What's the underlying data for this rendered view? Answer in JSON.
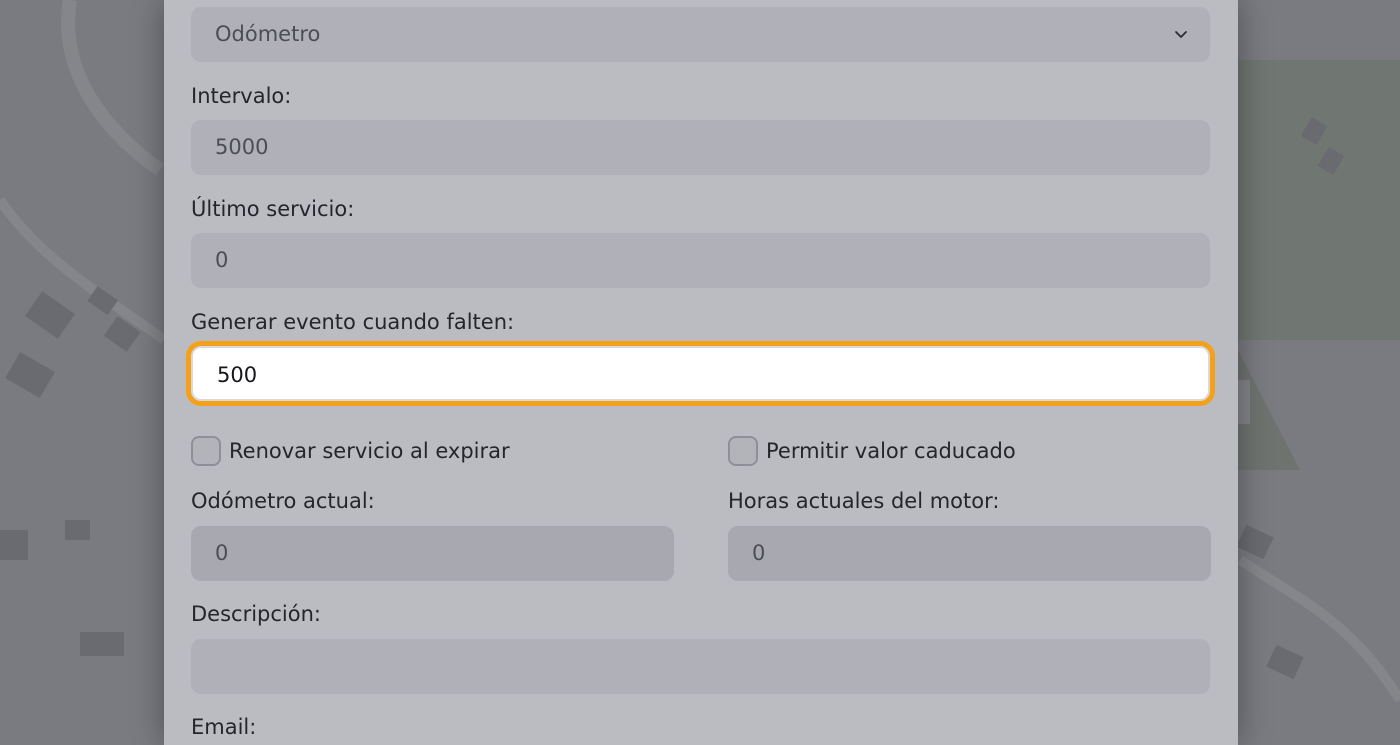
{
  "form": {
    "type_select": {
      "value": "Odómetro"
    },
    "interval": {
      "label": "Intervalo:",
      "value": "5000"
    },
    "last_service": {
      "label": "Último servicio:",
      "value": "0"
    },
    "event_threshold": {
      "label": "Generar evento cuando falten:",
      "value": "500"
    },
    "renew_checkbox": {
      "label": "Renovar servicio al expirar",
      "checked": false
    },
    "allow_expired_checkbox": {
      "label": "Permitir valor caducado",
      "checked": false
    },
    "current_odometer": {
      "label": "Odómetro actual:",
      "value": "0"
    },
    "current_engine_hours": {
      "label": "Horas actuales del motor:",
      "value": "0"
    },
    "description": {
      "label": "Descripción:",
      "value": ""
    },
    "email": {
      "label": "Email:"
    }
  },
  "colors": {
    "focus_ring": "#f3a118",
    "modal_bg": "#bbbcc1",
    "input_bg": "#b0b1b8"
  }
}
